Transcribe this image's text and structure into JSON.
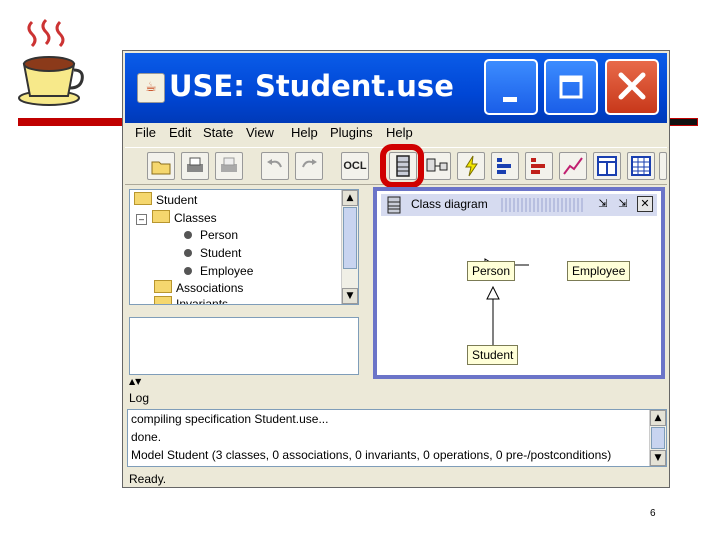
{
  "window": {
    "title": "USE: Student.use"
  },
  "menu": [
    "File",
    "Edit",
    "State",
    "View",
    "Help",
    "Plugins",
    "Help"
  ],
  "toolbar": {
    "ocl_label": "OCL"
  },
  "tree": {
    "root": "Student",
    "classes_label": "Classes",
    "class_items": [
      "Person",
      "Student",
      "Employee"
    ],
    "associations_label": "Associations",
    "invariants_label": "Invariants"
  },
  "diagram": {
    "title": "Class diagram",
    "classes": {
      "person": "Person",
      "employee": "Employee",
      "student": "Student"
    }
  },
  "log": {
    "title": "Log",
    "lines": [
      "compiling specification Student.use...",
      "done.",
      "Model Student (3 classes, 0 associations, 0 invariants, 0 operations, 0 pre-/postconditions)"
    ]
  },
  "status": "Ready.",
  "page_number": "6",
  "colors": {
    "slide_rule": "#c00000",
    "title_bar": "#0a5ce8",
    "highlight_ring": "#d00000"
  }
}
